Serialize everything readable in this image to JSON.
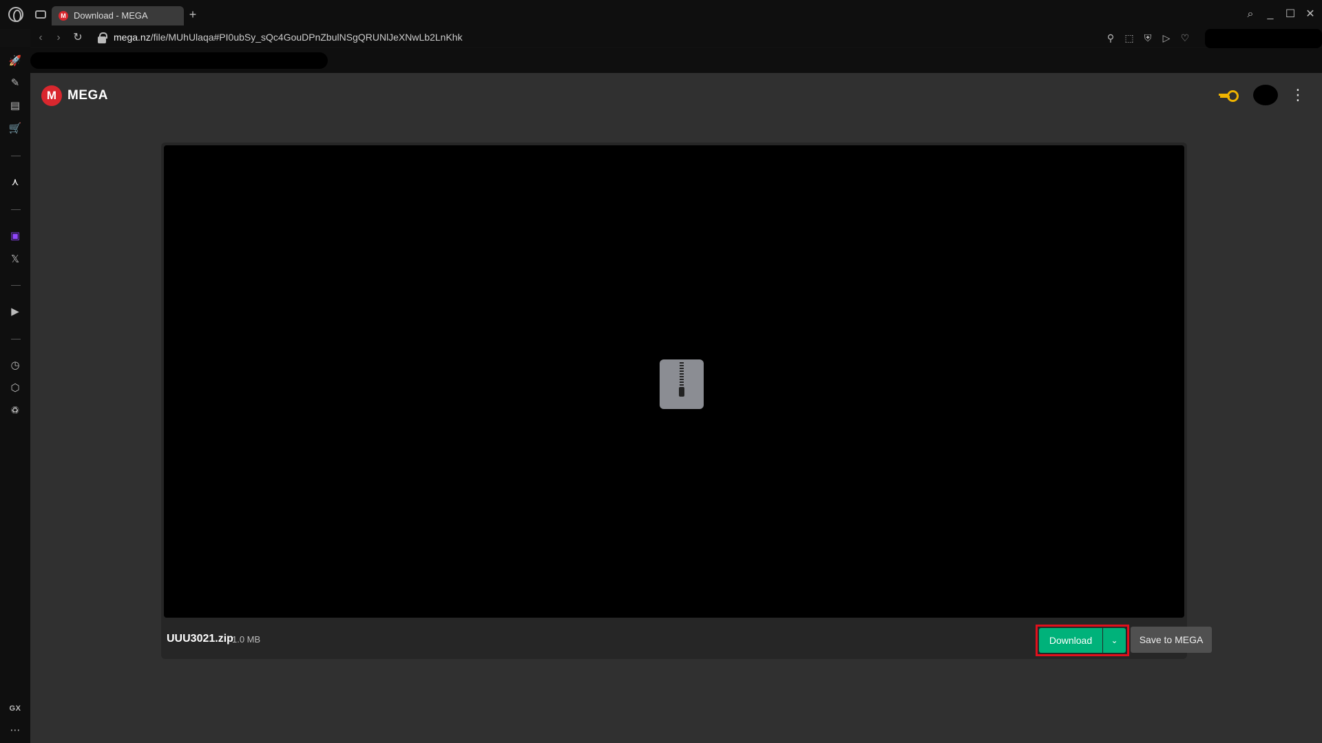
{
  "tab": {
    "favicon": "M",
    "title": "Download - MEGA",
    "new_tab": "+"
  },
  "window": {
    "search": "⌕",
    "minimize": "_",
    "maximize": "☐",
    "close": "✕"
  },
  "address": {
    "back": "‹",
    "forward": "›",
    "reload": "↻",
    "url_host": "mega.nz",
    "url_path": "/file/MUhUlaqa#PI0ubSy_sQc4GouDPnZbulNSgQRUNlJeXNwLb2LnKhk"
  },
  "toolbar_icons": {
    "pin": "⚲",
    "snapshot": "⬚",
    "shield": "⛨",
    "play": "▷",
    "heart": "♡"
  },
  "sidebar": {
    "icons": [
      "🚀",
      "✎",
      "▤",
      "🛒",
      "—",
      "⋏",
      "—",
      "▣",
      "𝕏",
      "—",
      "▶",
      "—",
      "◷",
      "⬡",
      "♽"
    ],
    "gx": "GX",
    "more": "⋯"
  },
  "header": {
    "logo_letter": "M",
    "brand": "MEGA",
    "menu": "⋮"
  },
  "file": {
    "name": "UUU3021.zip",
    "size": "1.0 MB"
  },
  "buttons": {
    "download": "Download",
    "download_options": "⌄",
    "save": "Save to MEGA"
  },
  "colors": {
    "brand_red": "#d9272e",
    "download_green": "#00b27a",
    "highlight_red": "#e0101c",
    "key_gold": "#f0b400"
  }
}
